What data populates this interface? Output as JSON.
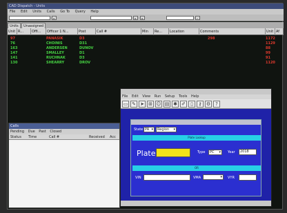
{
  "main_window": {
    "title": "CAD Dispatch - Units",
    "menu": [
      "File",
      "Edit",
      "Units",
      "Calls",
      "Go To",
      "Query",
      "Help"
    ],
    "tabs": [
      "Units",
      "Unassigned"
    ],
    "columns": [
      "Unit",
      "R...",
      "Offi...",
      "Officer 1 N...",
      "Post",
      "Call #",
      "Min",
      "Re...",
      "Location",
      "Comments",
      "Unit",
      "Af"
    ],
    "rows": [
      {
        "unit": "97",
        "officer_name": "PANASIK",
        "post": "D3",
        "comment_num": "298",
        "unit2": "1172",
        "color": "red"
      },
      {
        "unit": "76",
        "officer_name": "CHOINIS",
        "post": "D31",
        "comment_num": "",
        "unit2": "1129",
        "color": "green"
      },
      {
        "unit": "163",
        "officer_name": "ANDERSEN",
        "post": "DUNOV",
        "comment_num": "",
        "unit2": "88",
        "color": "green"
      },
      {
        "unit": "147",
        "officer_name": "SMALLEY",
        "post": "D1",
        "comment_num": "",
        "unit2": "99",
        "color": "green"
      },
      {
        "unit": "141",
        "officer_name": "RUCHNAK",
        "post": "D3",
        "comment_num": "",
        "unit2": "91",
        "color": "green"
      },
      {
        "unit": "130",
        "officer_name": "SHEARRY",
        "post": "DROV",
        "comment_num": "",
        "unit2": "1120",
        "color": "green"
      }
    ]
  },
  "calls_window": {
    "title": "Calls",
    "menu": [
      "Pending",
      "Due",
      "Past",
      "Closed"
    ],
    "columns": [
      "Status",
      "Time",
      "Call #",
      "Received",
      "Acc"
    ]
  },
  "plate_window": {
    "menu": [
      "File",
      "Edit",
      "View",
      "Run",
      "Setup",
      "Tools",
      "Help"
    ],
    "state_label": "State",
    "state_value": "PA",
    "region_value": "Region",
    "section1_label": "Plate Lookup",
    "plate_label": "Plate:",
    "type_label": "Type",
    "type_value": "PC",
    "year_label": "Year",
    "year_value": "2018",
    "section2_label": "OR",
    "vin_label": "VIN",
    "vma_label": "VMA",
    "vyr_label": "VYR"
  },
  "colors": {
    "red": "#e23a2e",
    "green": "#46d443",
    "plate_bg": "#1f22a8",
    "plate_input": "#f2e21a",
    "section_bar": "#27d0e6"
  }
}
